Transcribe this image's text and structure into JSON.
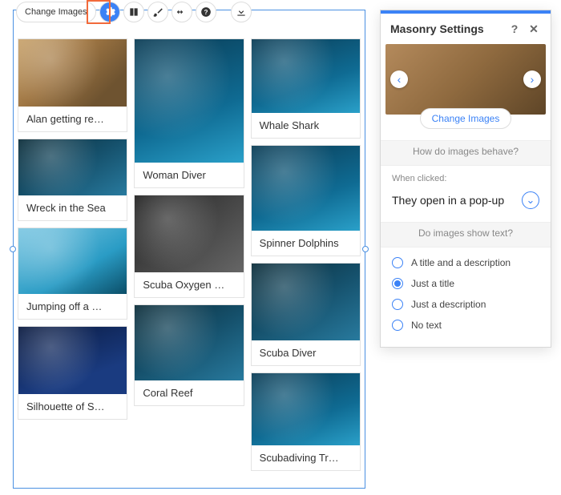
{
  "toolbar": {
    "change_images": "Change Images",
    "icons": [
      "gear-icon",
      "column-icon",
      "brush-icon",
      "hstretch-icon",
      "help-icon",
      "download-icon"
    ]
  },
  "gallery": {
    "columns": [
      [
        {
          "title": "Alan getting re…",
          "thumb_h": 84,
          "cls": "t-man"
        },
        {
          "title": "Wreck in the Sea",
          "thumb_h": 70,
          "cls": "t-reef"
        },
        {
          "title": "Jumping off a …",
          "thumb_h": 82,
          "cls": "t-jump"
        },
        {
          "title": "Silhouette of S…",
          "thumb_h": 84,
          "cls": "t-sil"
        }
      ],
      [
        {
          "title": "Woman Diver",
          "thumb_h": 154,
          "cls": "t-diver"
        },
        {
          "title": "Scuba Oxygen …",
          "thumb_h": 96,
          "cls": "t-gear"
        },
        {
          "title": "Coral Reef",
          "thumb_h": 94,
          "cls": "t-reef"
        }
      ],
      [
        {
          "title": "Whale Shark",
          "thumb_h": 92,
          "cls": "t-diver"
        },
        {
          "title": "Spinner Dolphins",
          "thumb_h": 106,
          "cls": "t-diver"
        },
        {
          "title": "Scuba Diver",
          "thumb_h": 96,
          "cls": "t-reef"
        },
        {
          "title": "Scubadiving Tr…",
          "thumb_h": 90,
          "cls": "t-diver"
        }
      ]
    ]
  },
  "panel": {
    "title": "Masonry Settings",
    "change_btn": "Change Images",
    "q1": "How do images behave?",
    "when_clicked_label": "When clicked:",
    "when_clicked_value": "They open in a pop-up",
    "q2": "Do images show text?",
    "text_options": [
      {
        "label": "A title and a description",
        "checked": false
      },
      {
        "label": "Just a title",
        "checked": true
      },
      {
        "label": "Just a description",
        "checked": false
      },
      {
        "label": "No text",
        "checked": false
      }
    ]
  }
}
